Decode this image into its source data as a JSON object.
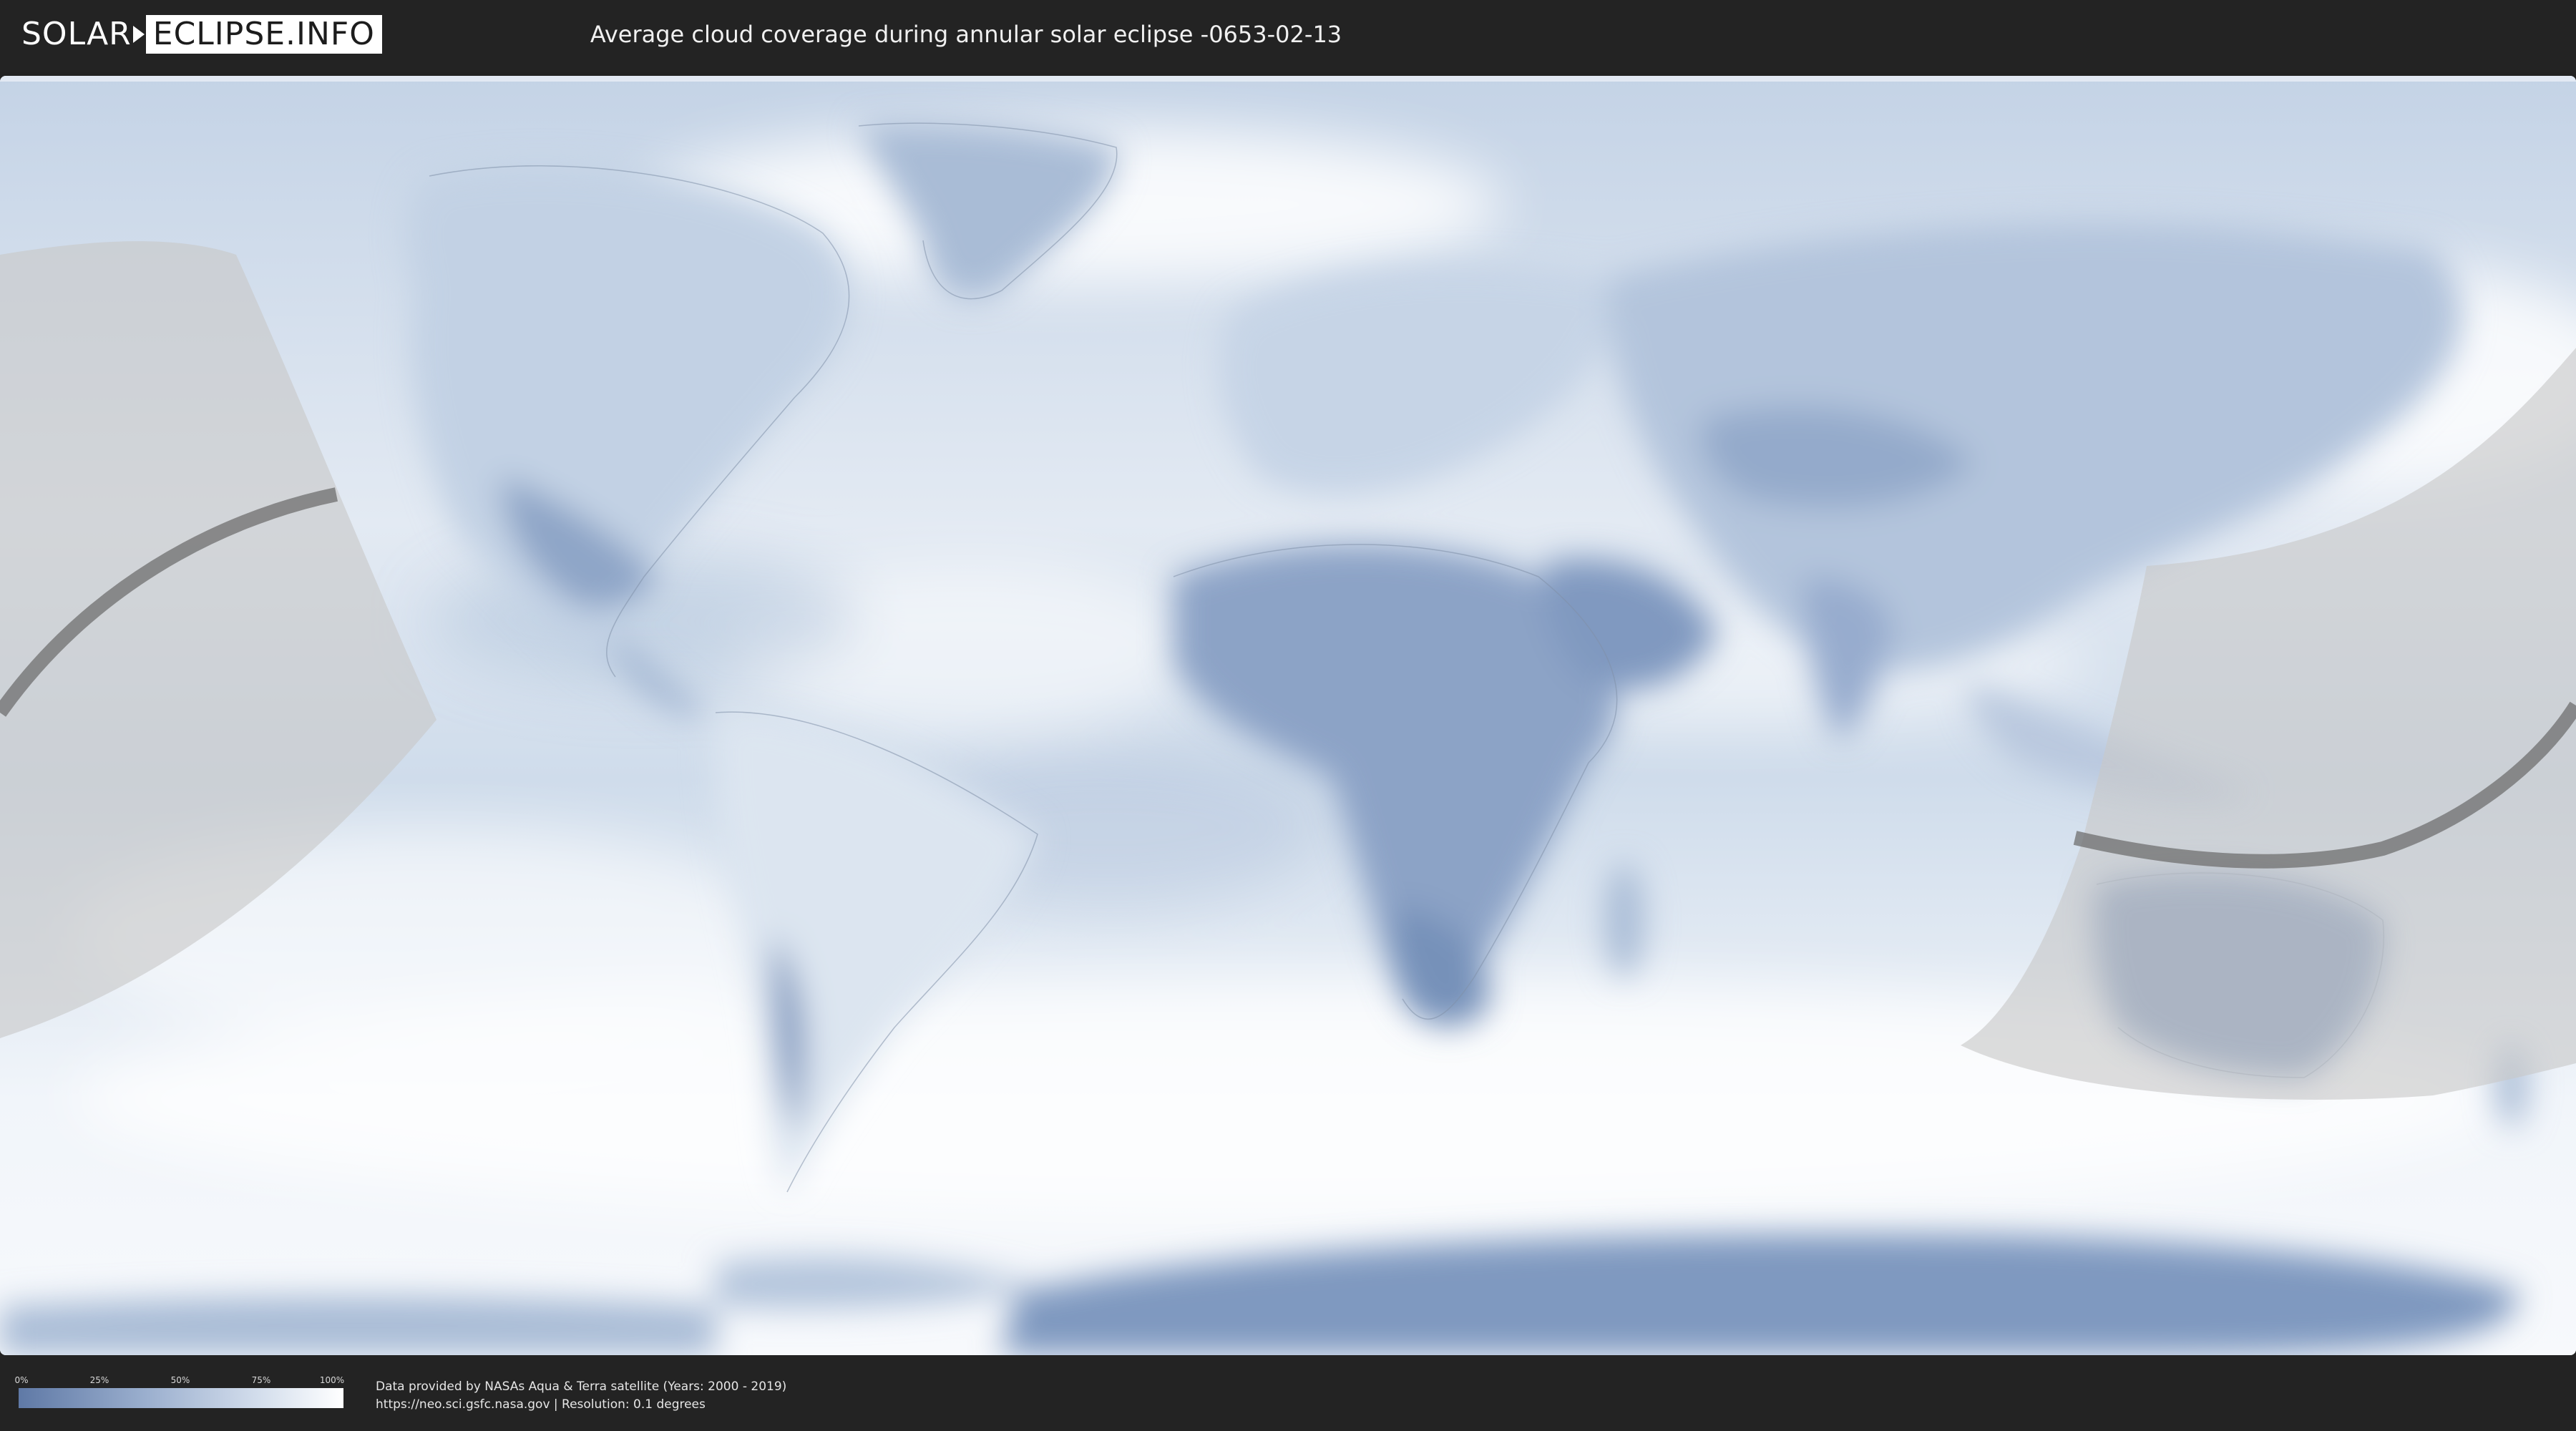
{
  "header": {
    "logo_left": "SOLAR",
    "logo_right": "ECLIPSE.INFO",
    "title": "Average cloud coverage during annular solar eclipse -0653-02-13"
  },
  "legend": {
    "ticks": [
      "0%",
      "25%",
      "50%",
      "75%",
      "100%"
    ]
  },
  "footer": {
    "source_line": "Data provided by NASAs Aqua & Terra satellite (Years: 2000 - 2019)",
    "url_line": "https://neo.sci.gsfc.nasa.gov | Resolution: 0.1 degrees"
  },
  "colors": {
    "ocean_base": "#dde6f1",
    "cloud_dense": "#ffffff",
    "clear_sky": "#5f79a6",
    "eclipse_zone": "#c8c8c8",
    "eclipse_path": "#6f6f6f",
    "header_bg": "#232323"
  },
  "icons": {
    "logo_arrow": "arrow-icon"
  }
}
